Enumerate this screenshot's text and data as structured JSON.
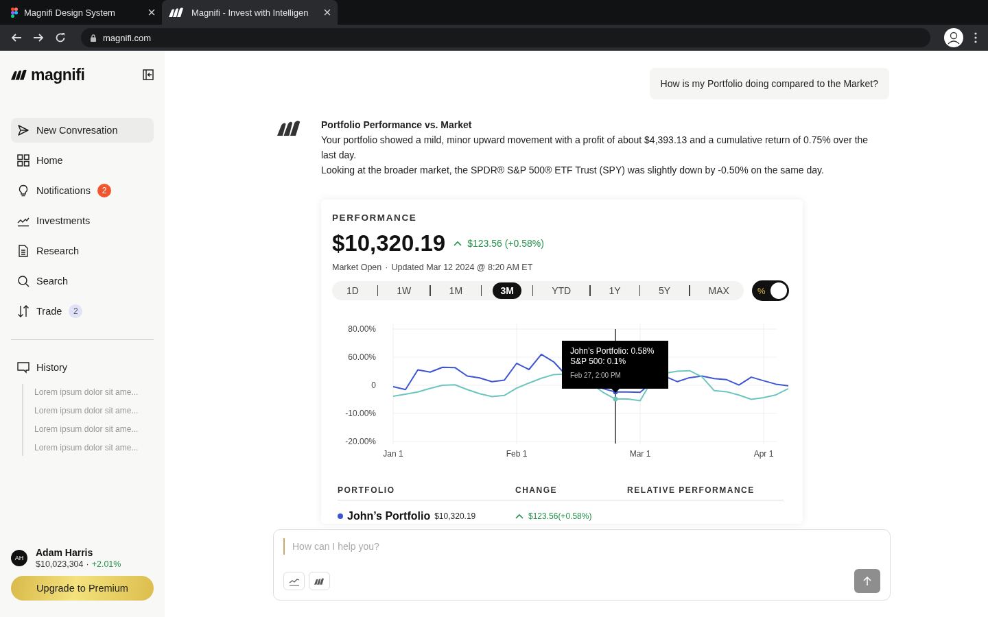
{
  "browser": {
    "tabs": [
      {
        "title": "Magnifi Design System",
        "selected": false
      },
      {
        "title": "Magnifi - Invest with Intelligen",
        "selected": true
      }
    ],
    "address": "magnifi.com"
  },
  "sidebar": {
    "logo": "magnifi",
    "items": [
      {
        "label": "New Convresation",
        "selected": true
      },
      {
        "label": "Home",
        "selected": false
      },
      {
        "label": "Notifications",
        "selected": false,
        "badge": {
          "text": "2",
          "kind": "alert"
        }
      },
      {
        "label": "Investments",
        "selected": false
      },
      {
        "label": "Research",
        "selected": false
      },
      {
        "label": "Search",
        "selected": false
      },
      {
        "label": "Trade",
        "selected": false,
        "badge": {
          "text": "2",
          "kind": "count"
        }
      }
    ],
    "history": {
      "label": "History",
      "items": [
        "Lorem ipsum dolor sit ame...",
        "Lorem ipsum dolor sit ame...",
        "Lorem ipsum dolor sit ame...",
        "Lorem ipsum dolor sit ame..."
      ]
    },
    "user": {
      "initials": "AH",
      "name": "Adam Harris",
      "balance": "$10,023,304",
      "separator": "·",
      "change": "+2.01%"
    },
    "upgrade": "Upgrade to Premium"
  },
  "conversation": {
    "question": "How is my Portfolio doing compared to the Market?",
    "answer": {
      "title": "Portfolio Performance vs. Market",
      "paragraphs": [
        "Your portfolio showed a mild, minor upward movement with a profit of about $4,393.13 and a cumulative return of 0.75% over the last day.",
        "Looking at the broader market, the SPDR® S&P 500® ETF Trust (SPY) was slightly down by -0.50% on the same day."
      ]
    }
  },
  "performance": {
    "heading": "PERFORMANCE",
    "value": "$10,320.19",
    "change": "$123.56 (+0.58%)",
    "status": "Market Open",
    "separator": "·",
    "updated": "Updated Mar 12 2024 @ 8:20 AM ET",
    "ranges": [
      {
        "label": "1D",
        "selected": false
      },
      {
        "label": "1W",
        "selected": false
      },
      {
        "label": "1M",
        "selected": false
      },
      {
        "label": "3M",
        "selected": true
      },
      {
        "label": "YTD",
        "selected": false
      },
      {
        "label": "1Y",
        "selected": false
      },
      {
        "label": "5Y",
        "selected": false
      },
      {
        "label": "MAX",
        "selected": false
      }
    ],
    "percent_toggle": {
      "label": "%",
      "on": true
    },
    "chart": {
      "y_labels": [
        "80.00%",
        "60.00%",
        "0",
        "-10.00%",
        "-20.00%"
      ],
      "x_labels": [
        "Jan 1",
        "Feb 1",
        "Mar 1",
        "Apr 1"
      ],
      "tooltip": {
        "lines": [
          "John’s Portfolio: 0.58%",
          "S&P 500: 0.1%"
        ],
        "date": "Feb 27, 2:00 PM"
      }
    },
    "table": {
      "columns": [
        "PORTFOLIO",
        "CHANGE",
        "RELATIVE PERFORMANCE"
      ],
      "rows": [
        {
          "name": "John’s Portfolio",
          "color": "#3d55d4",
          "value": "$10,320.19",
          "change": "$123.56(+0.58%)"
        }
      ]
    }
  },
  "composer": {
    "placeholder": "How can I help you?"
  }
}
